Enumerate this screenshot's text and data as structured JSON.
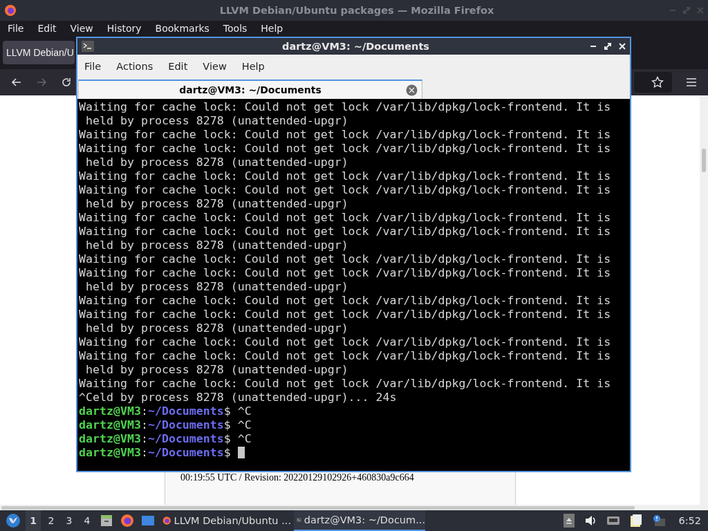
{
  "firefox": {
    "title": "LLVM Debian/Ubuntu packages — Mozilla Firefox",
    "menu": [
      "File",
      "Edit",
      "View",
      "History",
      "Bookmarks",
      "Tools",
      "Help"
    ],
    "tabs": [
      {
        "label": "LLVM Debian/U",
        "selected": true
      }
    ],
    "page": {
      "lines": [
        "00:19:55 UTC / Revision: 20220129102926+460830a9c664"
      ]
    }
  },
  "terminal": {
    "title": "dartz@VM3: ~/Documents",
    "menu": [
      "File",
      "Actions",
      "Edit",
      "View",
      "Help"
    ],
    "tabs": [
      {
        "label": "dartz@VM3: ~/Documents",
        "selected": true
      }
    ],
    "output": [
      "Waiting for cache lock: Could not get lock /var/lib/dpkg/lock-frontend. It is",
      " held by process 8278 (unattended-upgr)",
      "Waiting for cache lock: Could not get lock /var/lib/dpkg/lock-frontend. It is",
      "Waiting for cache lock: Could not get lock /var/lib/dpkg/lock-frontend. It is",
      " held by process 8278 (unattended-upgr)",
      "Waiting for cache lock: Could not get lock /var/lib/dpkg/lock-frontend. It is",
      "Waiting for cache lock: Could not get lock /var/lib/dpkg/lock-frontend. It is",
      " held by process 8278 (unattended-upgr)",
      "Waiting for cache lock: Could not get lock /var/lib/dpkg/lock-frontend. It is",
      "Waiting for cache lock: Could not get lock /var/lib/dpkg/lock-frontend. It is",
      " held by process 8278 (unattended-upgr)",
      "Waiting for cache lock: Could not get lock /var/lib/dpkg/lock-frontend. It is",
      "Waiting for cache lock: Could not get lock /var/lib/dpkg/lock-frontend. It is",
      " held by process 8278 (unattended-upgr)",
      "Waiting for cache lock: Could not get lock /var/lib/dpkg/lock-frontend. It is",
      "Waiting for cache lock: Could not get lock /var/lib/dpkg/lock-frontend. It is",
      " held by process 8278 (unattended-upgr)",
      "Waiting for cache lock: Could not get lock /var/lib/dpkg/lock-frontend. It is",
      "Waiting for cache lock: Could not get lock /var/lib/dpkg/lock-frontend. It is",
      " held by process 8278 (unattended-upgr)",
      "Waiting for cache lock: Could not get lock /var/lib/dpkg/lock-frontend. It is",
      "^Celd by process 8278 (unattended-upgr)... 24s"
    ],
    "prompts": [
      {
        "user": "dartz@VM3",
        "separator": ":",
        "path": "~/Documents",
        "symbol": "$",
        "command": "^C",
        "cursor": false
      },
      {
        "user": "dartz@VM3",
        "separator": ":",
        "path": "~/Documents",
        "symbol": "$",
        "command": "^C",
        "cursor": false
      },
      {
        "user": "dartz@VM3",
        "separator": ":",
        "path": "~/Documents",
        "symbol": "$",
        "command": "^C",
        "cursor": false
      },
      {
        "user": "dartz@VM3",
        "separator": ":",
        "path": "~/Documents",
        "symbol": "$",
        "cursor": true
      }
    ]
  },
  "taskbar": {
    "workspaces": [
      {
        "label": "1",
        "selected": true
      },
      {
        "label": "2",
        "selected": false
      },
      {
        "label": "3",
        "selected": false
      },
      {
        "label": "4",
        "selected": false
      }
    ],
    "tasks": [
      {
        "kind": "browser",
        "label": "LLVM Debian/Ubuntu ...",
        "selected": false
      },
      {
        "kind": "terminal",
        "label": "dartz@VM3: ~/Docum...",
        "selected": true
      }
    ],
    "clock": "6:52"
  }
}
